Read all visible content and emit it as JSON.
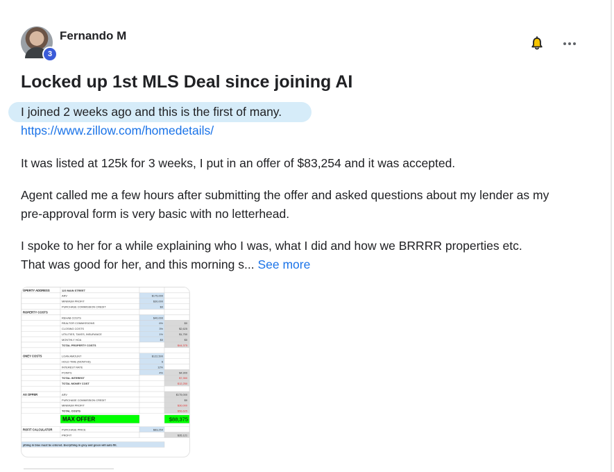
{
  "post": {
    "author": "Fernando M",
    "level": "3",
    "title": "Locked up 1st MLS Deal since joining AI",
    "intro": "I joined 2 weeks ago and this is the first of many.",
    "link": "https://www.zillow.com/homedetails/",
    "paragraph1": "It was listed at 125k for 3 weeks, I put in an offer of $83,254 and it was accepted.",
    "paragraph2_line1": "Agent called me a few hours after submitting the offer and asked questions about my lender as my",
    "paragraph2_line2": "pre-approval form is very basic with no letterhead.",
    "paragraph3_line1": "I spoke to her for a while explaining who I was, what I did and how we BRRRR properties etc.",
    "paragraph3_line2": "That was good for her, and this morning s...",
    "see_more": "See more",
    "icons": {
      "notify": "bell-icon",
      "menu": "more-options-icon"
    }
  },
  "spreadsheet": {
    "rows": [
      {
        "section": "OPERTY ADDRESS",
        "label": "123 MAIN STREET",
        "c1": "",
        "c2": ""
      },
      {
        "section": "",
        "label": "ARV",
        "c1": "$175,000",
        "c2": ""
      },
      {
        "section": "",
        "label": "MINIMUM PROFIT",
        "c1": "$30,000",
        "c2": ""
      },
      {
        "section": "",
        "label": "PURCHASE COMMISSION CREDIT",
        "c1": "$0",
        "c2": ""
      },
      {
        "section": "ROPERTY COSTS",
        "label": "",
        "c1": "",
        "c2": ""
      },
      {
        "section": "",
        "label": "REHAB COSTS",
        "c1": "$40,000",
        "c2": ""
      },
      {
        "section": "",
        "label": "REALTOR COMMISSIONS",
        "c1": "6%",
        "c2": "$0"
      },
      {
        "section": "",
        "label": "CLOSING COSTS",
        "c1": "3%",
        "c2": "$2,625"
      },
      {
        "section": "",
        "label": "UTILITIES, TAXES, INSURANCE",
        "c1": "1%",
        "c2": "$1,750"
      },
      {
        "section": "",
        "label": "MONTHLY HOA",
        "c1": "$0",
        "c2": "$0"
      },
      {
        "section": "",
        "label": "TOTAL PROPERTY COSTS",
        "c1": "",
        "c2": "$44,375"
      },
      {
        "section": "",
        "label": "",
        "c1": "",
        "c2": ""
      },
      {
        "section": "ONEY COSTS",
        "label": "LOAN AMOUNT",
        "c1": "$122,500",
        "c2": ""
      },
      {
        "section": "",
        "label": "HOLD TIME (MONTHS)",
        "c1": "6",
        "c2": ""
      },
      {
        "section": "",
        "label": "INTEREST RATE",
        "c1": "12%",
        "c2": ""
      },
      {
        "section": "",
        "label": "POINTS",
        "c1": "4%",
        "c2": "$4,900"
      },
      {
        "section": "",
        "label": "TOTAL INTEREST",
        "c1": "",
        "c2": "$7,350"
      },
      {
        "section": "",
        "label": "TOTAL MONEY COST",
        "c1": "",
        "c2": "$12,250"
      },
      {
        "section": "",
        "label": "",
        "c1": "",
        "c2": ""
      },
      {
        "section": "AX OFFER",
        "label": "ARV",
        "c1": "",
        "c2": "$175,000"
      },
      {
        "section": "",
        "label": "PURCHASE COMMISSION CREDIT",
        "c1": "",
        "c2": "$0"
      },
      {
        "section": "",
        "label": "MINIMUM PROFIT",
        "c1": "",
        "c2": "$30,000"
      },
      {
        "section": "",
        "label": "TOTAL COSTS",
        "c1": "",
        "c2": "$56,625"
      }
    ],
    "max_offer_label": "MAX OFFER",
    "max_offer_value": "$88,375",
    "calc_rows": [
      {
        "section": "ROFIT CALCULATOR",
        "label": "PURCHASE PRICE",
        "c1": "$83,254",
        "c2": ""
      },
      {
        "section": "",
        "label": "PROFIT",
        "c1": "",
        "c2": "$35,121"
      }
    ],
    "footer": "ything in blue must be entered. Everything in grey and green will auto fill."
  },
  "colors": {
    "link": "#1a73e8",
    "highlight": "#d6ecf9",
    "badge": "#3b5bd8",
    "max_offer": "#00ff00"
  }
}
